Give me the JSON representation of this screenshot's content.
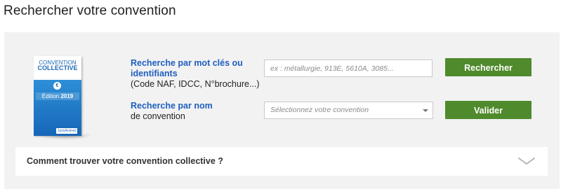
{
  "page_title": "Rechercher votre convention",
  "book": {
    "title_line1": "CONVENTION",
    "title_line2": "COLLECTIVE",
    "edition_prefix": "Édition",
    "edition_year": "2019",
    "publisher": "JurisAnimet",
    "emblem": "€"
  },
  "keyword_search": {
    "title_line1": "Recherche par mot clés ou",
    "title_line2": "identifiants",
    "subtitle": "(Code NAF, IDCC, N°brochure...)",
    "placeholder": "ex : métallurgie, 913E, 5610A, 3085...",
    "value": "",
    "button_label": "Rechercher"
  },
  "name_search": {
    "title": "Recherche par nom",
    "subtitle": "de convention",
    "select_placeholder": "Sélectionnez votre convention",
    "button_label": "Valider"
  },
  "accordion": {
    "label": "Comment trouver votre convention collective ?",
    "icon": "chevron-down-icon"
  },
  "colors": {
    "accent_blue": "#1f5fbf",
    "button_green": "#4f8a2c",
    "panel_bg": "#f2f2f2"
  }
}
